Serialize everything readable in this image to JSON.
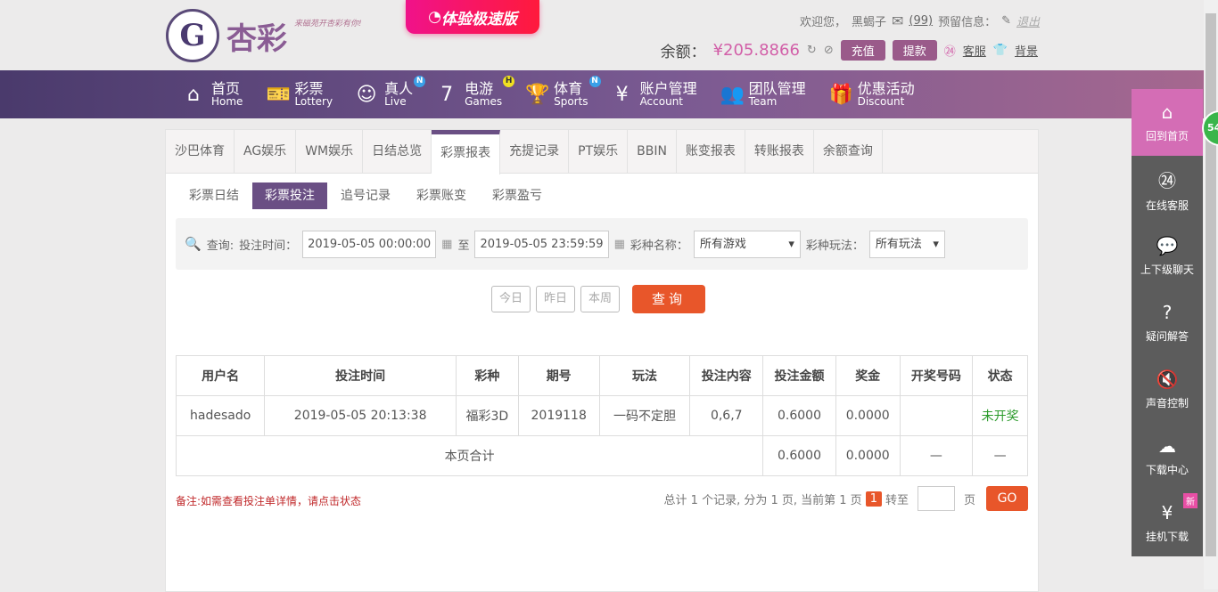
{
  "header": {
    "logo_text": "杏彩",
    "slogan": "来磁苑开杏彩有你!",
    "speed_button": "体验极速版",
    "welcome": "欢迎您，",
    "username": "黑蝎子",
    "mail_count": "(99)",
    "reserved_info": "预留信息：",
    "logout": "退出",
    "balance_label": "余额：",
    "balance": "¥205.8866",
    "deposit": "充值",
    "withdraw": "提款",
    "service": "客服",
    "background": "背景"
  },
  "nav": [
    {
      "cn": "首页",
      "en": "Home",
      "icon": "⌂"
    },
    {
      "cn": "彩票",
      "en": "Lottery",
      "icon": "🎫"
    },
    {
      "cn": "真人",
      "en": "Live",
      "icon": "☺",
      "badge": "N"
    },
    {
      "cn": "电游",
      "en": "Games",
      "icon": "7",
      "badge": "H"
    },
    {
      "cn": "体育",
      "en": "Sports",
      "icon": "🏆",
      "badge": "N"
    },
    {
      "cn": "账户管理",
      "en": "Account",
      "icon": "¥"
    },
    {
      "cn": "团队管理",
      "en": "Team",
      "icon": "👥"
    },
    {
      "cn": "优惠活动",
      "en": "Discount",
      "icon": "🎁"
    }
  ],
  "tabs": [
    "沙巴体育",
    "AG娱乐",
    "WM娱乐",
    "日结总览",
    "彩票报表",
    "充提记录",
    "PT娱乐",
    "BBIN",
    "账变报表",
    "转账报表",
    "余额查询"
  ],
  "active_tab": "彩票报表",
  "subtabs": [
    "彩票日结",
    "彩票投注",
    "追号记录",
    "彩票账变",
    "彩票盈亏"
  ],
  "filter": {
    "query_label": "查询:",
    "time_label": "投注时间：",
    "start": "2019-05-05 00:00:00",
    "to": "至",
    "end": "2019-05-05 23:59:59",
    "game_label": "彩种名称：",
    "game_value": "所有游戏",
    "play_label": "彩种玩法：",
    "play_value": "所有玩法",
    "today": "今日",
    "yesterday": "昨日",
    "week": "本周",
    "search": "查询"
  },
  "table": {
    "headers": [
      "用户名",
      "投注时间",
      "彩种",
      "期号",
      "玩法",
      "投注内容",
      "投注金额",
      "奖金",
      "开奖号码",
      "状态"
    ],
    "rows": [
      [
        "hadesado",
        "2019-05-05 20:13:38",
        "福彩3D",
        "2019118",
        "一码不定胆",
        "0,6,7",
        "0.6000",
        "0.0000",
        "",
        "未开奖"
      ]
    ],
    "total": {
      "label": "本页合计",
      "amount": "0.6000",
      "prize": "0.0000",
      "numbers": "—",
      "status": "—"
    },
    "status_color": "#2a9a2a"
  },
  "note": "备注:如需查看投注单详情，请点击状态",
  "pager": {
    "summary": "总计 1 个记录, 分为 1 页, 当前第 1 页",
    "current": "1",
    "goto": "转至",
    "page": "页",
    "go": "GO"
  },
  "sidebar": [
    {
      "label": "回到首页",
      "icon": "⌂"
    },
    {
      "label": "在线客服",
      "icon": "㉔"
    },
    {
      "label": "上下级聊天",
      "icon": "💬"
    },
    {
      "label": "疑问解答",
      "icon": "?"
    },
    {
      "label": "声音控制",
      "icon": "🔇"
    },
    {
      "label": "下载中心",
      "icon": "☁"
    },
    {
      "label": "挂机下载",
      "icon": "¥",
      "badge": "新"
    }
  ],
  "float_ball": "54"
}
